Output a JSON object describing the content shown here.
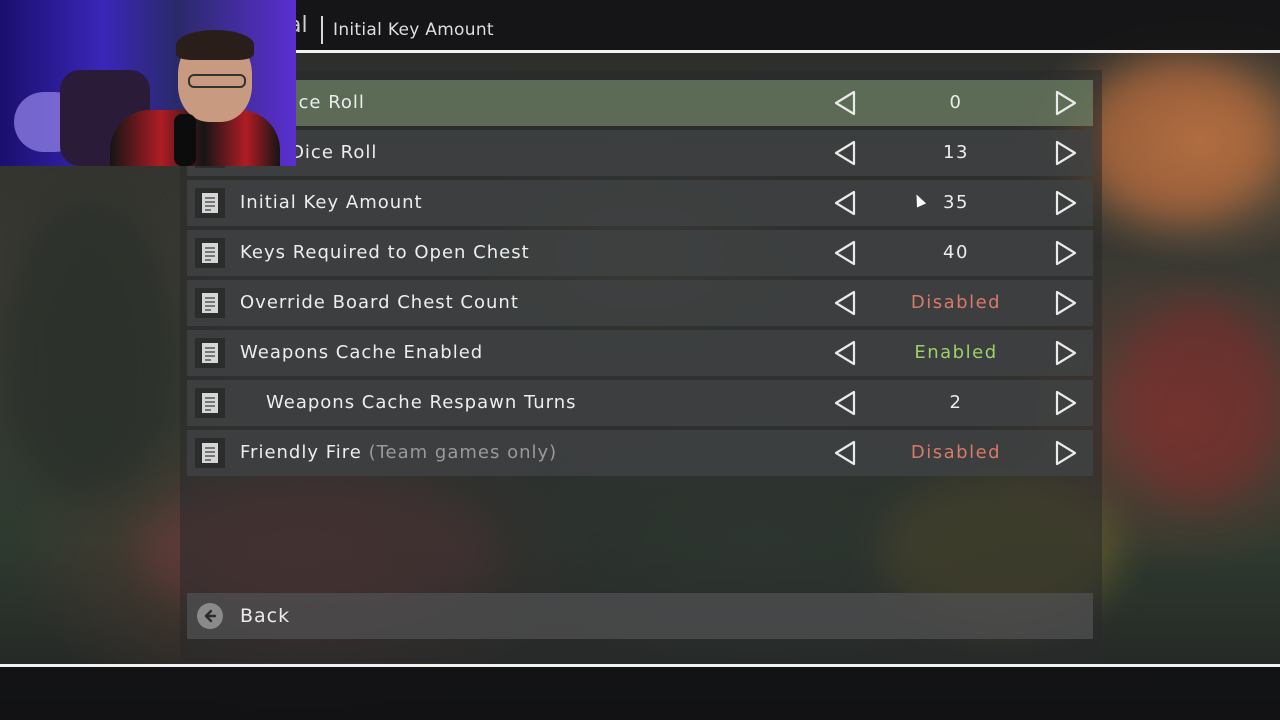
{
  "header": {
    "previous_crumb": "al",
    "title": "Initial Key Amount"
  },
  "settings": [
    {
      "label": "um Dice Roll",
      "value": "0",
      "value_color": "#ececec",
      "highlighted": true
    },
    {
      "label": "num Dice Roll",
      "value": "13",
      "value_color": "#ececec",
      "highlighted": false
    },
    {
      "label": "Initial Key Amount",
      "value": "35",
      "value_color": "#ececec",
      "highlighted": false
    },
    {
      "label": "Keys Required to Open Chest",
      "value": "40",
      "value_color": "#ececec",
      "highlighted": false
    },
    {
      "label": "Override Board Chest Count",
      "value": "Disabled",
      "value_color": "#d9796a",
      "highlighted": false
    },
    {
      "label": "Weapons Cache Enabled",
      "value": "Enabled",
      "value_color": "#9fcf6a",
      "highlighted": false
    },
    {
      "label": "Weapons Cache Respawn Turns",
      "value": "2",
      "value_color": "#ececec",
      "highlighted": false,
      "indented": true
    },
    {
      "label": "Friendly Fire",
      "sublabel": "(Team games only)",
      "value": "Disabled",
      "value_color": "#d9796a",
      "highlighted": false
    }
  ],
  "back": {
    "label": "Back"
  },
  "icons": {
    "row_icon": "document-icon",
    "decrease": "arrow-left-icon",
    "increase": "arrow-right-icon",
    "back": "back-arrow-icon"
  }
}
